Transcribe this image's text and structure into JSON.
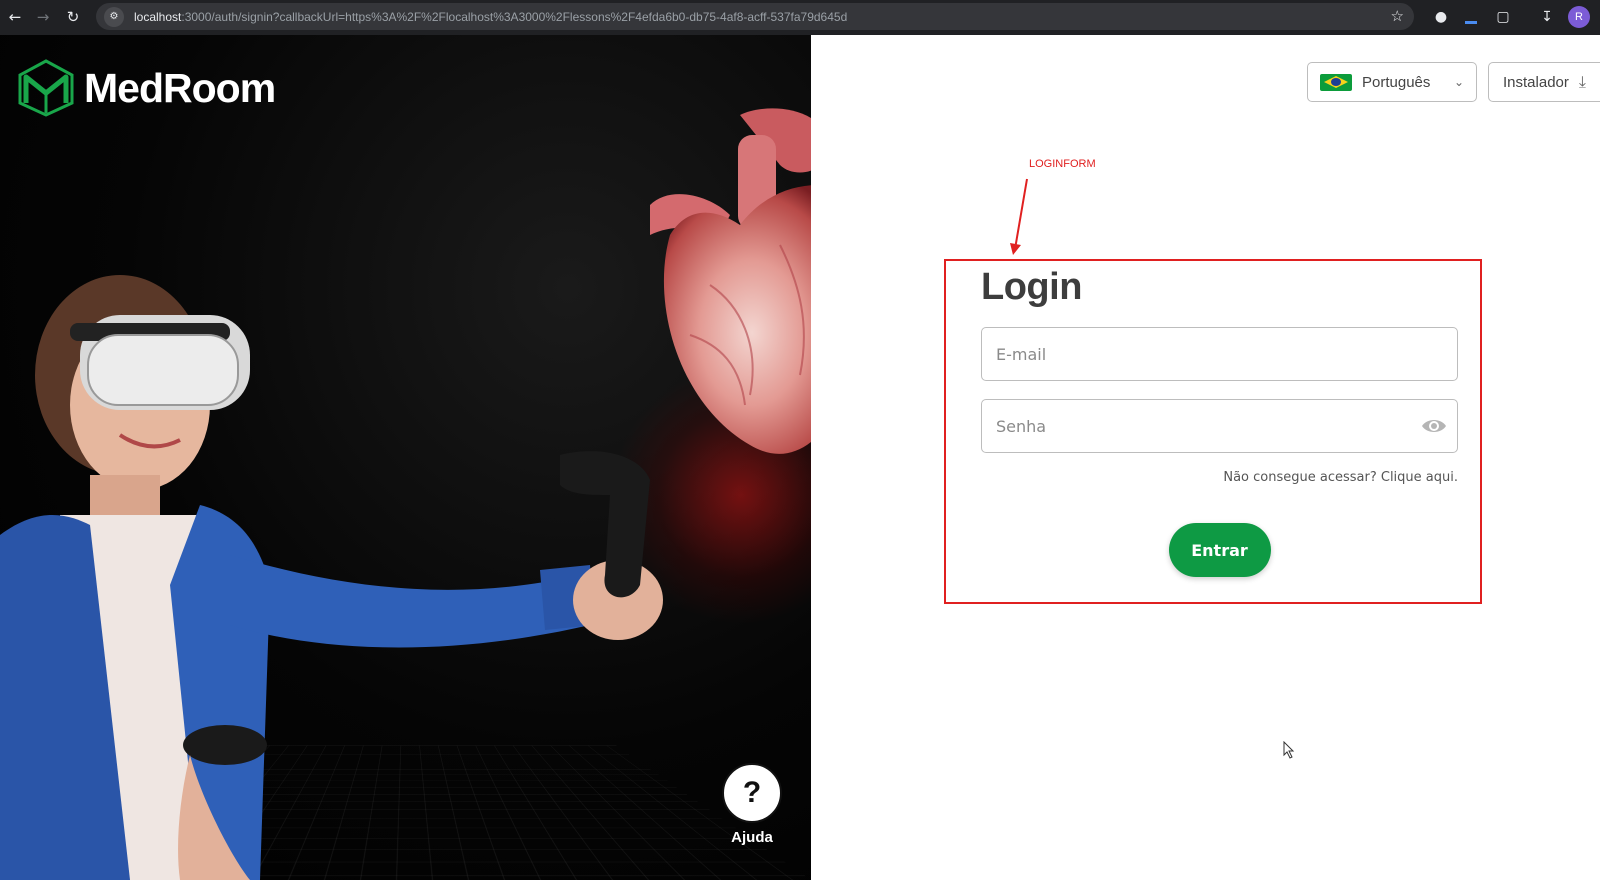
{
  "browser": {
    "url_host": "localhost",
    "url_rest": ":3000/auth/signin?callbackUrl=https%3A%2F%2Flocalhost%3A3000%2Flessons%2F4efda6b0-db75-4af8-acff-537fa79d645d",
    "profile_initial": "R"
  },
  "hero": {
    "brand_name": "MedRoom",
    "help_label": "Ajuda",
    "help_symbol": "?"
  },
  "header": {
    "language_label": "Português",
    "installer_label": "Instalador"
  },
  "annotation": {
    "label": "LOGINFORM",
    "color": "#e02020"
  },
  "form": {
    "title": "Login",
    "email_placeholder": "E-mail",
    "password_placeholder": "Senha",
    "forgot_text": "Não consegue acessar? Clique aqui.",
    "submit_label": "Entrar",
    "accent_color": "#0e9a44"
  }
}
